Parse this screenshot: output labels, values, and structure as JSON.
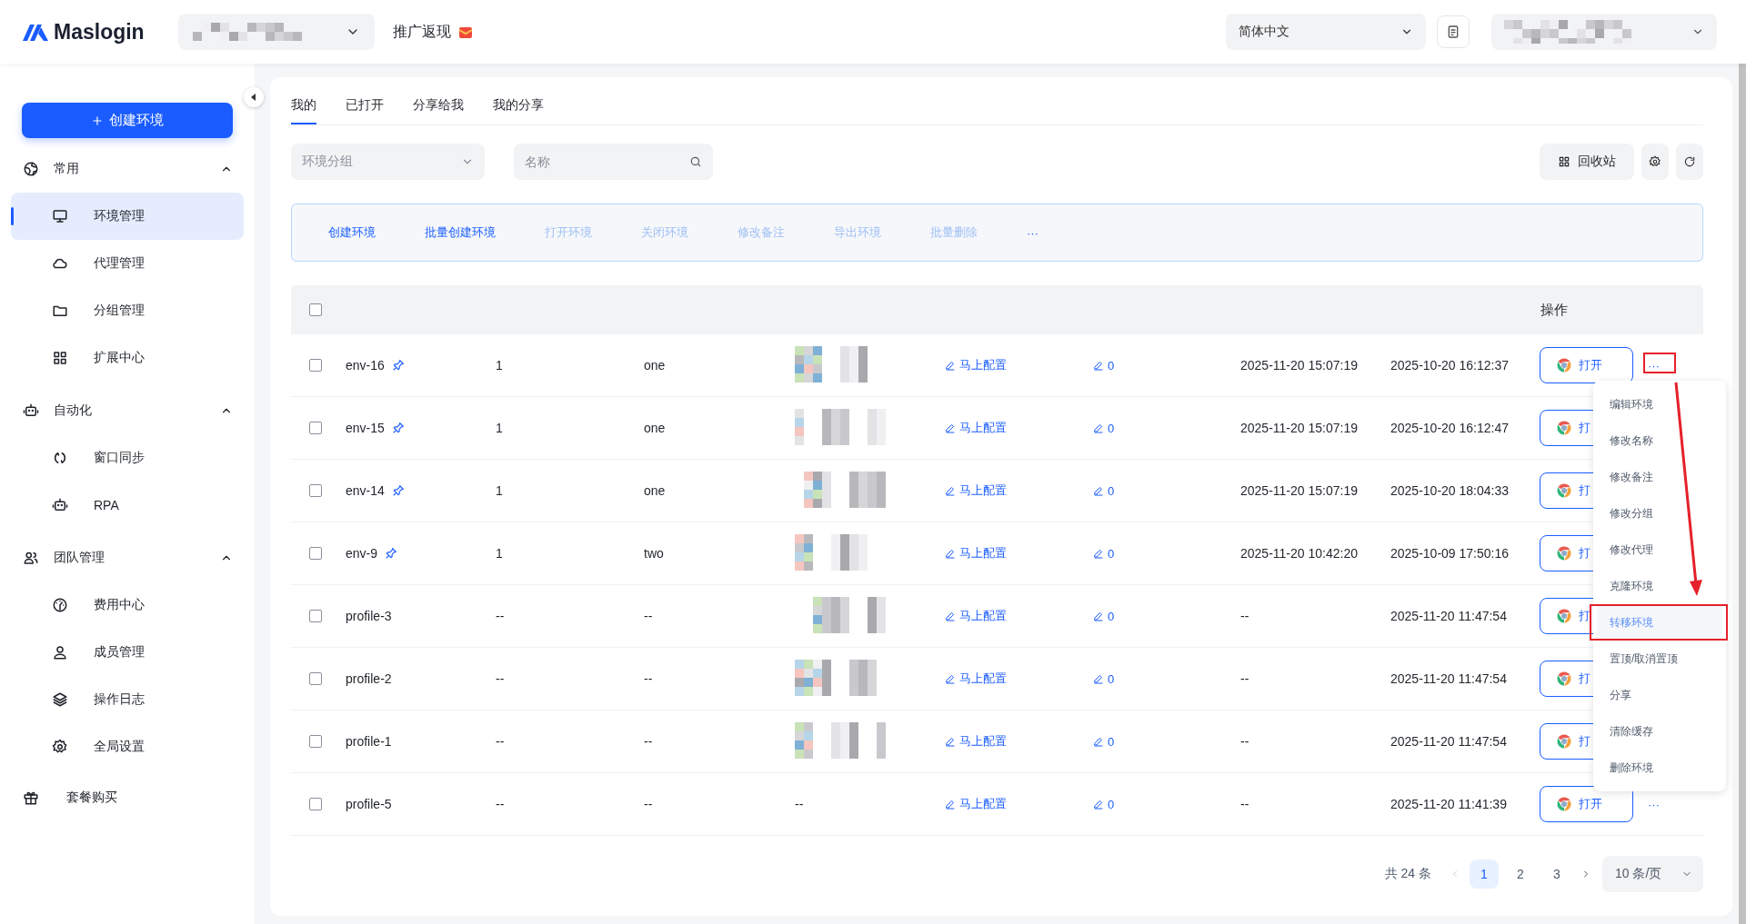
{
  "header": {
    "logo": "Maslogin",
    "promo": "推广返现",
    "language": "简体中文"
  },
  "sidebar": {
    "create_button": "创建环境",
    "groups": [
      {
        "label": "常用",
        "expanded": true,
        "items": [
          {
            "label": "环境管理",
            "selected": true
          },
          {
            "label": "代理管理",
            "selected": false
          },
          {
            "label": "分组管理",
            "selected": false
          },
          {
            "label": "扩展中心",
            "selected": false
          }
        ]
      },
      {
        "label": "自动化",
        "expanded": true,
        "items": [
          {
            "label": "窗口同步",
            "selected": false
          },
          {
            "label": "RPA",
            "selected": false
          }
        ]
      },
      {
        "label": "团队管理",
        "expanded": true,
        "items": [
          {
            "label": "费用中心",
            "selected": false
          },
          {
            "label": "成员管理",
            "selected": false
          },
          {
            "label": "操作日志",
            "selected": false
          },
          {
            "label": "全局设置",
            "selected": false
          }
        ]
      }
    ],
    "footer_item": "套餐购买"
  },
  "tabs": [
    {
      "label": "我的",
      "selected": true
    },
    {
      "label": "已打开",
      "selected": false
    },
    {
      "label": "分享给我",
      "selected": false
    },
    {
      "label": "我的分享",
      "selected": false
    }
  ],
  "filters": {
    "group_placeholder": "环境分组",
    "search_placeholder": "名称",
    "recycle_button": "回收站"
  },
  "actions": [
    {
      "label": "创建环境",
      "disabled": false
    },
    {
      "label": "批量创建环境",
      "disabled": false
    },
    {
      "label": "打开环境",
      "disabled": true
    },
    {
      "label": "关闭环境",
      "disabled": true
    },
    {
      "label": "修改备注",
      "disabled": true
    },
    {
      "label": "导出环境",
      "disabled": true
    },
    {
      "label": "批量删除",
      "disabled": true
    },
    {
      "label": "···",
      "disabled": false
    }
  ],
  "table": {
    "header_checked": false,
    "action_header": "操作",
    "rows": [
      {
        "checked": false,
        "name": "env-16",
        "pinned": true,
        "column_3": "1",
        "column_4": "one",
        "config": "马上配置",
        "count": "0",
        "column_8": "2025-11-20 15:07:19",
        "column_9": "2025-10-20 16:12:37",
        "open_label": "打开",
        "more": "···"
      },
      {
        "checked": false,
        "name": "env-15",
        "pinned": true,
        "column_3": "1",
        "column_4": "one",
        "config": "马上配置",
        "count": "0",
        "column_8": "2025-11-20 15:07:19",
        "column_9": "2025-10-20 16:12:47",
        "open_label": "打"
      },
      {
        "checked": false,
        "name": "env-14",
        "pinned": true,
        "column_3": "1",
        "column_4": "one",
        "config": "马上配置",
        "count": "0",
        "column_8": "2025-11-20 15:07:19",
        "column_9": "2025-10-20 18:04:33",
        "open_label": "打"
      },
      {
        "checked": false,
        "name": "env-9",
        "pinned": true,
        "column_3": "1",
        "column_4": "two",
        "config": "马上配置",
        "count": "0",
        "column_8": "2025-11-20 10:42:20",
        "column_9": "2025-10-09 17:50:16",
        "open_label": "打"
      },
      {
        "checked": false,
        "name": "profile-3",
        "pinned": false,
        "column_3": "--",
        "column_4": "--",
        "config": "马上配置",
        "count": "0",
        "column_8": "--",
        "column_9": "2025-11-20 11:47:54",
        "open_label": "打"
      },
      {
        "checked": false,
        "name": "profile-2",
        "pinned": false,
        "column_3": "--",
        "column_4": "--",
        "config": "马上配置",
        "count": "0",
        "column_8": "--",
        "column_9": "2025-11-20 11:47:54",
        "open_label": "打"
      },
      {
        "checked": false,
        "name": "profile-1",
        "pinned": false,
        "column_3": "--",
        "column_4": "--",
        "config": "马上配置",
        "count": "0",
        "column_8": "--",
        "column_9": "2025-11-20 11:47:54",
        "open_label": "打"
      },
      {
        "checked": false,
        "name": "profile-5",
        "pinned": false,
        "column_3": "--",
        "column_4": "--",
        "column_5": "--",
        "config": "马上配置",
        "count": "0",
        "column_8": "--",
        "column_9": "2025-11-20 11:41:39",
        "open_label": "打开",
        "more": "···"
      }
    ]
  },
  "row_menu": {
    "items": [
      {
        "label": "编辑环境",
        "selected": false
      },
      {
        "label": "修改名称",
        "selected": false
      },
      {
        "label": "修改备注",
        "selected": false
      },
      {
        "label": "修改分组",
        "selected": false
      },
      {
        "label": "修改代理",
        "selected": false
      },
      {
        "label": "克隆环境",
        "selected": false
      },
      {
        "label": "转移环境",
        "selected": true
      },
      {
        "label": "置顶/取消置顶",
        "selected": false
      },
      {
        "label": "分享",
        "selected": false
      },
      {
        "label": "清除缓存",
        "selected": false
      },
      {
        "label": "删除环境",
        "selected": false
      }
    ]
  },
  "pagination": {
    "total": "共 24 条",
    "pages": [
      {
        "label": "1",
        "selected": true
      },
      {
        "label": "2",
        "selected": false
      },
      {
        "label": "3",
        "selected": false
      }
    ],
    "page_size": "10 条/页"
  }
}
